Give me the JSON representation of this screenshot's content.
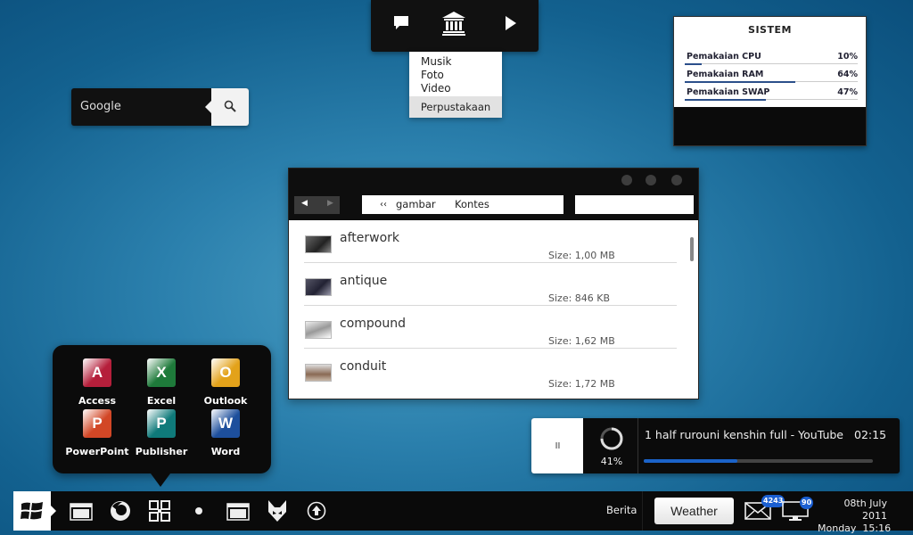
{
  "top_widget": {
    "icons": [
      "chat-bubble-icon",
      "library-icon",
      "play-icon"
    ],
    "menu_items": [
      "Musik",
      "Foto",
      "Video"
    ],
    "menu_footer": "Perpustakaan"
  },
  "google_search": {
    "label": "Google",
    "icon": "search-icon"
  },
  "sistem": {
    "title": "SISTEM",
    "rows": [
      {
        "label": "Pemakaian CPU",
        "value": "10%",
        "fraction": 0.1
      },
      {
        "label": "Pemakaian RAM",
        "value": "64%",
        "fraction": 0.64
      },
      {
        "label": "Pemakaian SWAP",
        "value": "47%",
        "fraction": 0.47
      }
    ]
  },
  "file_window": {
    "back_glyph": "◀",
    "forward_glyph": "▶",
    "path_glyph": "‹‹",
    "path": [
      "gambar",
      "Kontes"
    ],
    "files": [
      {
        "name": "afterwork",
        "size_label": "Size:",
        "size": "1,00 MB"
      },
      {
        "name": "antique",
        "size_label": "Size:",
        "size": "846 KB"
      },
      {
        "name": "compound",
        "size_label": "Size:",
        "size": "1,62 MB"
      },
      {
        "name": "conduit",
        "size_label": "Size:",
        "size": "1,72 MB"
      }
    ]
  },
  "office_apps": [
    {
      "label": "Access",
      "letter": "A",
      "color": "#b51f3b",
      "icon": "access-icon"
    },
    {
      "label": "Excel",
      "letter": "X",
      "color": "#1e7a3a",
      "icon": "excel-icon"
    },
    {
      "label": "Outlook",
      "letter": "O",
      "color": "#e3a21a",
      "icon": "outlook-icon"
    },
    {
      "label": "PowerPoint",
      "letter": "P",
      "color": "#d24726",
      "icon": "powerpoint-icon"
    },
    {
      "label": "Publisher",
      "letter": "P",
      "color": "#0f7a7a",
      "icon": "publisher-icon"
    },
    {
      "label": "Word",
      "letter": "W",
      "color": "#1d4f9c",
      "icon": "word-icon"
    }
  ],
  "media_player": {
    "pause_glyph": "II",
    "percent": "41%",
    "title": "1 half rurouni kenshin full - YouTube",
    "time": "02:15",
    "progress": 0.41
  },
  "taskbar": {
    "icons": [
      "windows-start-icon",
      "folder-icon",
      "firefox-icon",
      "apps-grid-icon",
      "dot-icon",
      "folder-icon",
      "foobar-icon",
      "upload-icon"
    ],
    "berita": "Berita",
    "weather": "Weather",
    "mail_count": "4243",
    "monitor_count": "90",
    "date": "08th July 2011",
    "day_time": "Monday  15:16"
  },
  "colors": {
    "accent": "#1b63c9",
    "background": "#2b80ad",
    "panel": "#0b0b0b"
  }
}
